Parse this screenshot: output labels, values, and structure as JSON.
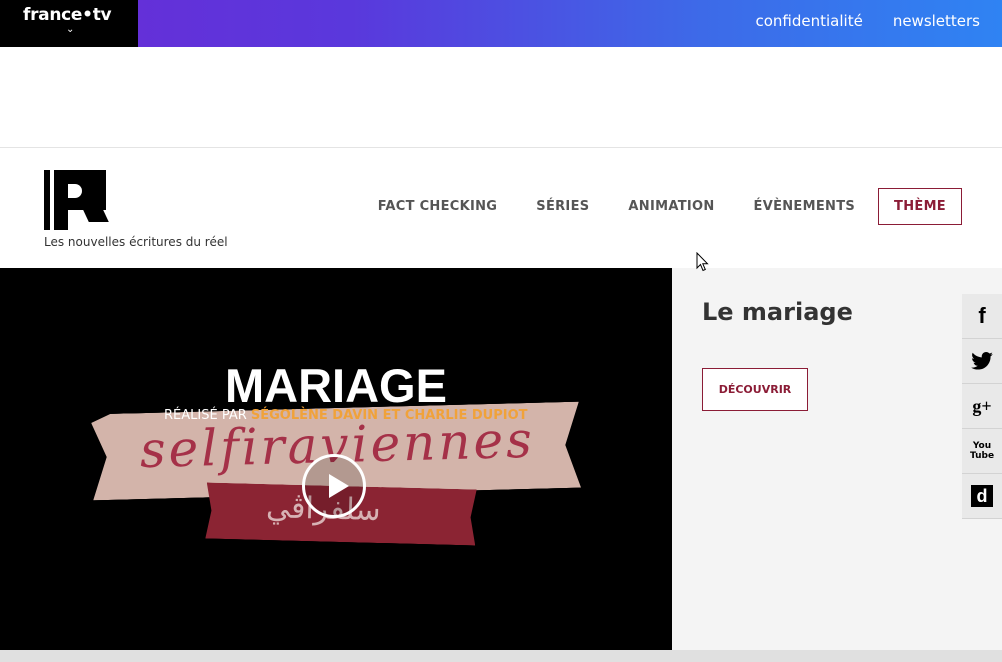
{
  "topbar": {
    "brand": "france•tv",
    "chevron": "⌄",
    "links": [
      "confidentialité",
      "newsletters"
    ]
  },
  "header": {
    "logo_icon": "r-logo",
    "tagline": "Les nouvelles écritures du réel",
    "nav": [
      "FACT CHECKING",
      "SÉRIES",
      "ANIMATION",
      "ÉVÈNEMENTS"
    ],
    "theme_button": "THÈME"
  },
  "video": {
    "title": "MARIAGE",
    "credits_prefix": "RÉALISÉ PAR ",
    "credits_names": "SÉGOLÈNE DAVIN ET CHARLIE DUPIOT",
    "ribbon_script": "selfiraviennes",
    "ribbon_arabic": "سلفراڤي",
    "play_icon": "play-icon"
  },
  "side": {
    "title": "Le mariage",
    "cta": "DÉCOUVRIR"
  },
  "social": [
    {
      "name": "facebook-icon",
      "glyph": "f"
    },
    {
      "name": "twitter-icon",
      "glyph": "🐦"
    },
    {
      "name": "google-plus-icon",
      "glyph": "g+"
    },
    {
      "name": "youtube-icon",
      "glyph": "You Tube"
    },
    {
      "name": "dailymotion-icon",
      "glyph": "d"
    }
  ]
}
